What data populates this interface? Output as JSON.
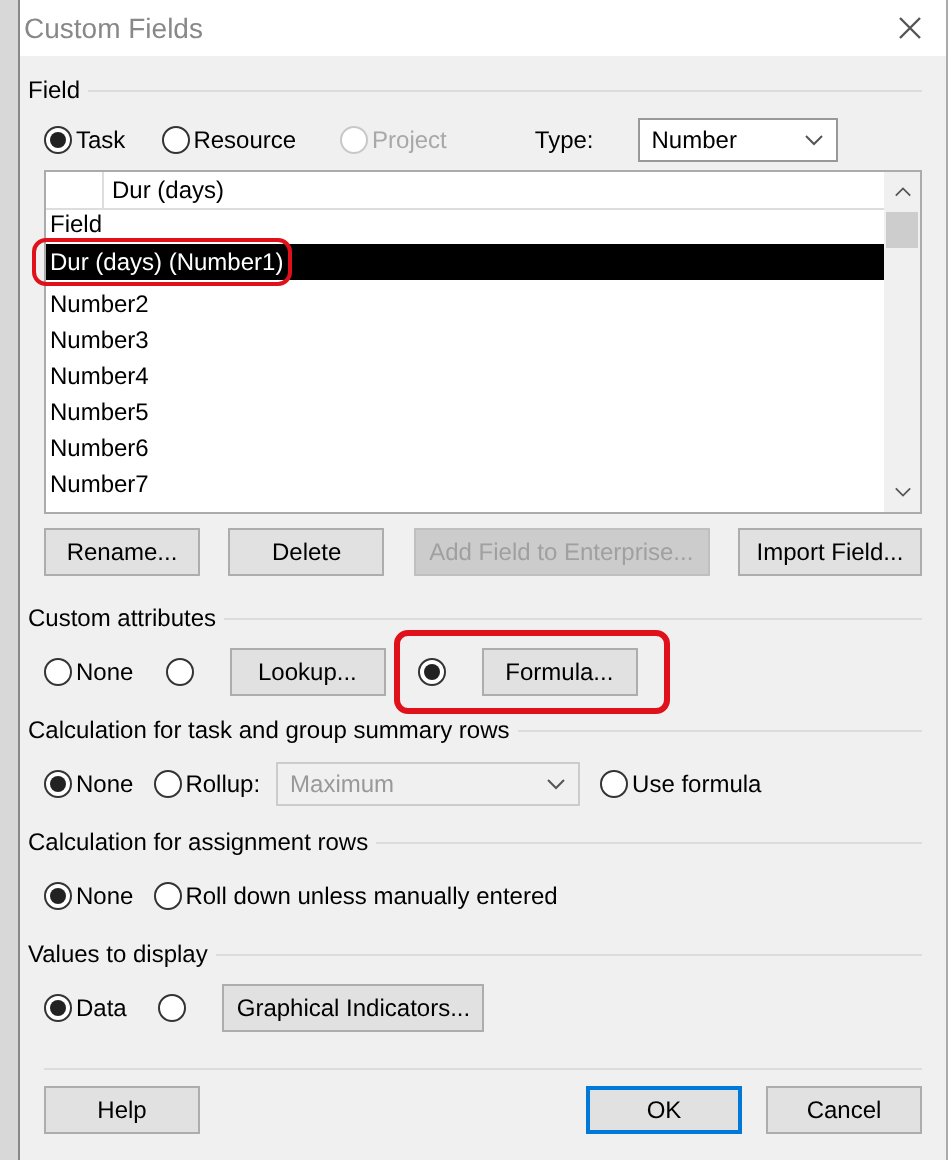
{
  "window": {
    "title": "Custom Fields"
  },
  "field_group": {
    "label": "Field",
    "entity_options": [
      {
        "label": "Task",
        "selected": true,
        "disabled": false
      },
      {
        "label": "Resource",
        "selected": false,
        "disabled": false
      },
      {
        "label": "Project",
        "selected": false,
        "disabled": true
      }
    ],
    "type_label": "Type:",
    "type_value": "Number",
    "name_edit": "Dur (days)",
    "list_header": "Field",
    "fields": [
      {
        "label": "Dur (days) (Number1)",
        "selected": true,
        "annotated": true
      },
      {
        "label": "Number2",
        "selected": false,
        "annotated": false
      },
      {
        "label": "Number3",
        "selected": false,
        "annotated": false
      },
      {
        "label": "Number4",
        "selected": false,
        "annotated": false
      },
      {
        "label": "Number5",
        "selected": false,
        "annotated": false
      },
      {
        "label": "Number6",
        "selected": false,
        "annotated": false
      },
      {
        "label": "Number7",
        "selected": false,
        "annotated": false
      }
    ],
    "buttons": [
      {
        "label": "Rename...",
        "disabled": false
      },
      {
        "label": "Delete",
        "disabled": false
      },
      {
        "label": "Add Field to Enterprise...",
        "disabled": true
      },
      {
        "label": "Import Field...",
        "disabled": false
      }
    ]
  },
  "sections": [
    {
      "label": "Custom attributes",
      "options": [
        {
          "kind": "radio",
          "label": "None",
          "selected": false
        },
        {
          "kind": "radio-button",
          "button": "Lookup...",
          "selected": false,
          "annotated": false
        },
        {
          "kind": "radio-button",
          "button": "Formula...",
          "selected": true,
          "annotated": true
        }
      ]
    },
    {
      "label": "Calculation for task and group summary rows",
      "options": [
        {
          "kind": "radio",
          "label": "None",
          "selected": true
        },
        {
          "kind": "radio-select",
          "label": "Rollup:",
          "selected": false,
          "select_value": "Maximum",
          "select_disabled": true
        },
        {
          "kind": "radio",
          "label": "Use formula",
          "selected": false
        }
      ]
    },
    {
      "label": "Calculation for assignment rows",
      "options": [
        {
          "kind": "radio",
          "label": "None",
          "selected": true
        },
        {
          "kind": "radio",
          "label": "Roll down unless manually entered",
          "selected": false
        }
      ]
    },
    {
      "label": "Values to display",
      "options": [
        {
          "kind": "radio",
          "label": "Data",
          "selected": true
        },
        {
          "kind": "radio-button",
          "button": "Graphical Indicators...",
          "selected": false,
          "annotated": false
        }
      ]
    }
  ],
  "footer_buttons": [
    {
      "label": "Help",
      "default": false
    },
    {
      "label": "OK",
      "default": true
    },
    {
      "label": "Cancel",
      "default": false
    }
  ]
}
